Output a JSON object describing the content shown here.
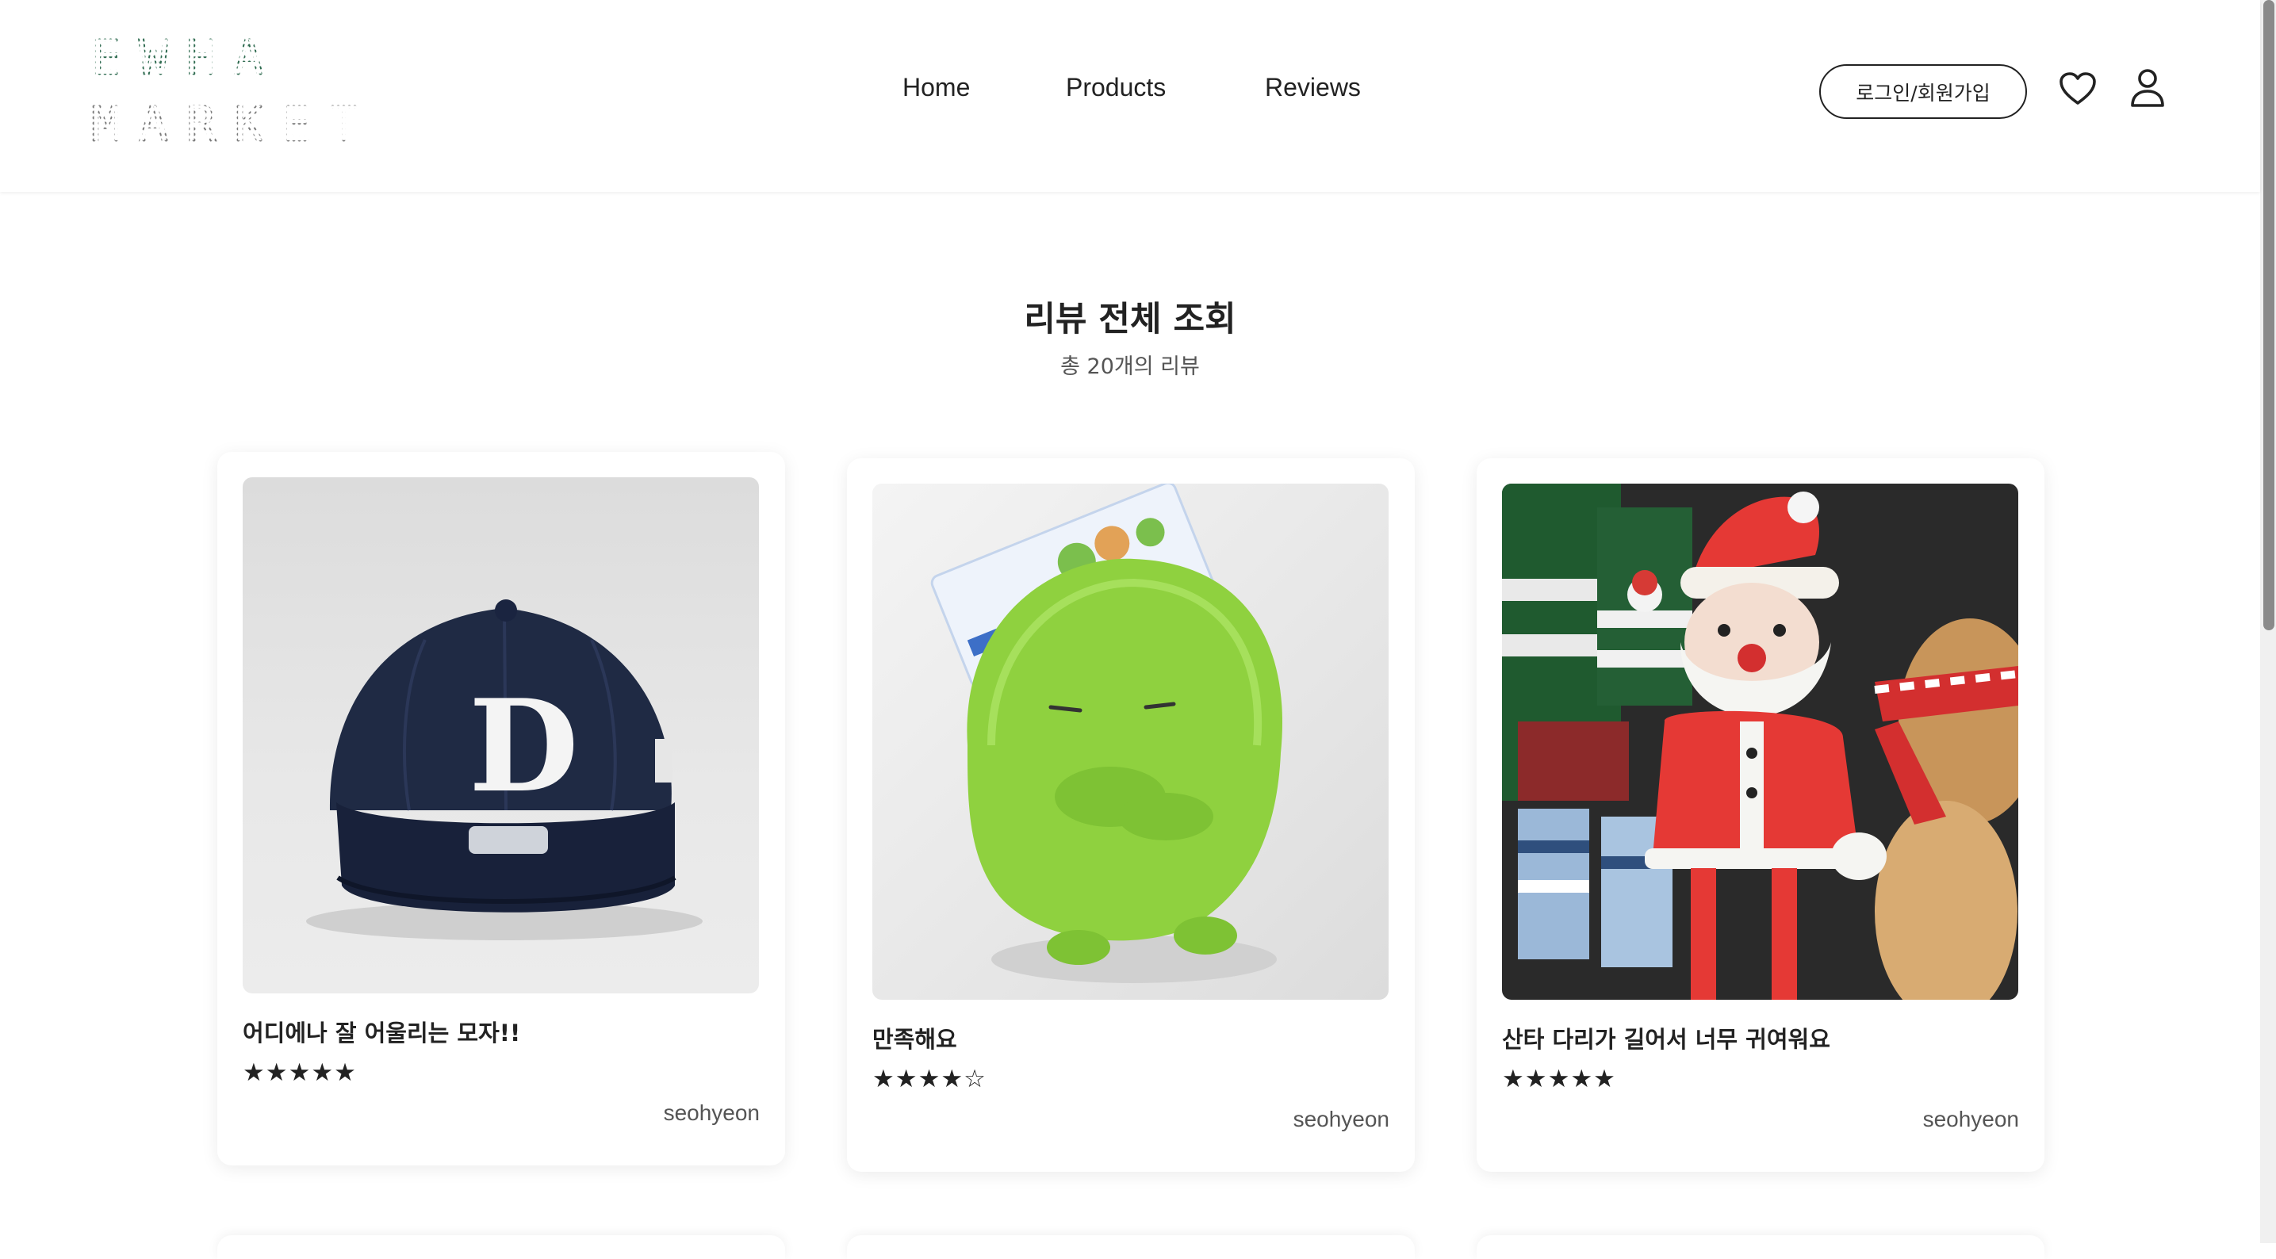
{
  "header": {
    "logo_line1": [
      "E",
      "W",
      "H",
      "A"
    ],
    "logo_line2": [
      "M",
      "A",
      "R",
      "K",
      "E",
      "T"
    ],
    "nav": [
      "Home",
      "Products",
      "Reviews"
    ],
    "login_label": "로그인/회원가입"
  },
  "page": {
    "title": "리뷰 전체 조회",
    "subtitle": "총 20개의 리뷰"
  },
  "reviews": [
    {
      "title": "어디에나 잘 어울리는 모자!!",
      "stars": "★★★★★",
      "rating": 5,
      "author": "seohyeon",
      "image": "navy-baseball-cap"
    },
    {
      "title": "만족해요",
      "stars": "★★★★☆",
      "rating": 4,
      "author": "seohyeon",
      "image": "green-plush-toy"
    },
    {
      "title": "산타 다리가 길어서 너무 귀여워요",
      "stars": "★★★★★",
      "rating": 5,
      "author": "seohyeon",
      "image": "santa-plush-doll"
    }
  ],
  "colors": {
    "logo_green": "#2d6a4f",
    "logo_gray": "#7a7a7a",
    "text": "#222222"
  }
}
